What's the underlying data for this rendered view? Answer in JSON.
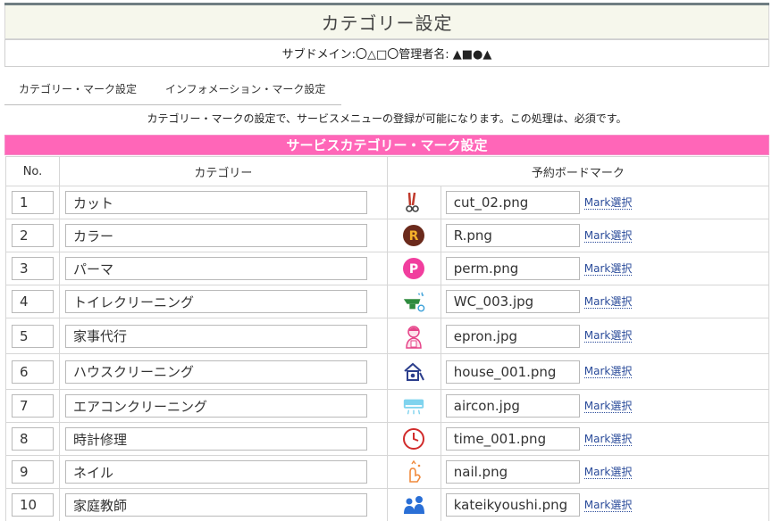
{
  "header": {
    "title": "カテゴリー設定",
    "sub_line": "サブドメイン:〇△□〇管理者名: ▲■●▲"
  },
  "tabs": [
    {
      "label": "カテゴリー・マーク設定"
    },
    {
      "label": "インフォメーション・マーク設定"
    }
  ],
  "description": "カテゴリー・マークの設定で、サービスメニューの登録が可能になります。この処理は、必須です。",
  "section": {
    "title": "サービスカテゴリー・マーク設定",
    "col_no": "No.",
    "col_category": "カテゴリー",
    "col_mark": "予約ボードマーク",
    "mark_button_label": "Mark選択"
  },
  "rows": [
    {
      "no": "1",
      "category": "カット",
      "file": "cut_02.png",
      "icon": "scissors-icon"
    },
    {
      "no": "2",
      "category": "カラー",
      "file": "R.png",
      "icon": "color-r-badge-icon"
    },
    {
      "no": "3",
      "category": "パーマ",
      "file": "perm.png",
      "icon": "perm-p-badge-icon"
    },
    {
      "no": "4",
      "category": "トイレクリーニング",
      "file": "WC_003.jpg",
      "icon": "toilet-cleaning-icon"
    },
    {
      "no": "5",
      "category": "家事代行",
      "file": "epron.jpg",
      "icon": "apron-woman-icon"
    },
    {
      "no": "6",
      "category": "ハウスクリーニング",
      "file": "house_001.png",
      "icon": "house-cleaning-icon"
    },
    {
      "no": "7",
      "category": "エアコンクリーニング",
      "file": "aircon.jpg",
      "icon": "air-conditioner-icon"
    },
    {
      "no": "8",
      "category": "時計修理",
      "file": "time_001.png",
      "icon": "clock-icon"
    },
    {
      "no": "9",
      "category": "ネイル",
      "file": "nail.png",
      "icon": "nail-hand-icon"
    },
    {
      "no": "10",
      "category": "家庭教師",
      "file": "kateikyoushi.png",
      "icon": "tutor-icon"
    }
  ],
  "colors": {
    "section_pink": "#ff66b8",
    "title_bg": "#f6f7ec",
    "link_blue": "#2a4b9a"
  }
}
